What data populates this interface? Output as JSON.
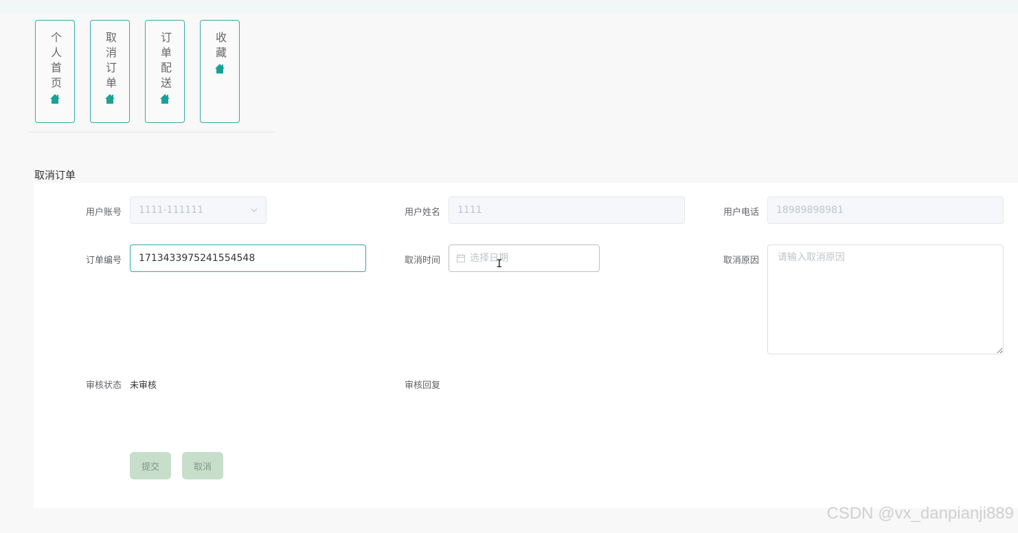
{
  "tabs": [
    {
      "label": "个人首页",
      "icon": "home-icon"
    },
    {
      "label": "取消订单",
      "icon": "home-icon"
    },
    {
      "label": "订单配送",
      "icon": "home-icon"
    },
    {
      "label": "收藏",
      "icon": "home-icon"
    }
  ],
  "accent_color": "#33aaa1",
  "section_title": "取消订单",
  "form": {
    "account": {
      "label": "用户账号",
      "value": "1111-111111"
    },
    "name": {
      "label": "用户姓名",
      "value": "1111"
    },
    "phone": {
      "label": "用户电话",
      "value": "18989898981"
    },
    "order_no": {
      "label": "订单编号",
      "value": "1713433975241554548"
    },
    "cancel_time": {
      "label": "取消时间",
      "placeholder": "选择日期"
    },
    "cancel_reason": {
      "label": "取消原因",
      "placeholder": "请输入取消原因"
    },
    "review_status": {
      "label": "审核状态",
      "value": "未审核"
    },
    "review_reply": {
      "label": "审核回复"
    }
  },
  "buttons": {
    "submit": "提交",
    "cancel": "取消"
  },
  "watermark": "CSDN @vx_danpianji889"
}
